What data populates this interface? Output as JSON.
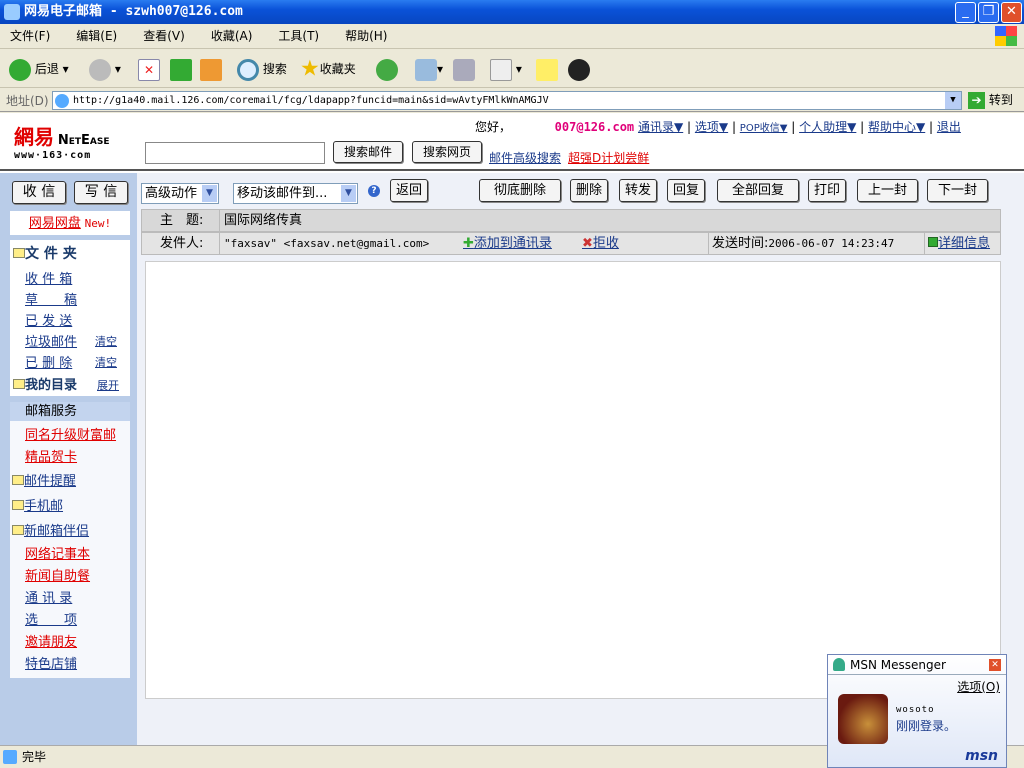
{
  "window": {
    "title": "网易电子邮箱 - szwh007@126.com"
  },
  "menu": [
    "文件(F)",
    "编辑(E)",
    "查看(V)",
    "收藏(A)",
    "工具(T)",
    "帮助(H)"
  ],
  "toolbar": {
    "back": "后退",
    "search": "搜索",
    "favorites": "收藏夹"
  },
  "address": {
    "label": "地址(D)",
    "url": "http://g1a40.mail.126.com/coremail/fcg/ldapapp?funcid=main&sid=wAvtyFMlkWnAMGJV",
    "go": "转到"
  },
  "header": {
    "logo_cn": "網易",
    "logo_en": "NetEase",
    "logo_url": "www·163·com",
    "greeting": "您好，",
    "user": "007@126.com",
    "nav": [
      "通讯录▼",
      "选项▼",
      "POP收信▼",
      "个人助理▼",
      "帮助中心▼",
      "退出"
    ],
    "search_mail": "搜索邮件",
    "search_web": "搜索网页",
    "adv_search": "邮件高级搜索",
    "promo": "超强D计划尝鲜"
  },
  "sidebar": {
    "receive": "收 信",
    "compose": "写 信",
    "netdisk": "网易网盘",
    "new": "New!",
    "folders_title": "文 件 夹",
    "folders": [
      {
        "label": "收 件 箱"
      },
      {
        "label": "草　　稿"
      },
      {
        "label": "已 发 送"
      },
      {
        "label": "垃圾邮件",
        "action": "清空"
      },
      {
        "label": "已 删 除",
        "action": "清空"
      }
    ],
    "mydir": "我的目录",
    "expand": "展开",
    "service_title": "邮箱服务",
    "services": [
      "同名升级财富邮",
      "精品贺卡",
      "邮件提醒",
      "手机邮",
      "新邮箱伴侣",
      "网络记事本",
      "新闻自助餐",
      "通 讯 录",
      "选　　项",
      "邀请朋友",
      "特色店铺"
    ]
  },
  "actions": {
    "advanced": "高级动作",
    "move": "移动该邮件到...",
    "back": "返回",
    "buttons": [
      "彻底删除",
      "删除",
      "转发",
      "回复",
      "全部回复",
      "打印",
      "上一封",
      "下一封"
    ]
  },
  "mail": {
    "subject_label": "主　题:",
    "subject": "国际网络传真",
    "from_label": "发件人:",
    "from": "\"faxsav\" <faxsav.net@gmail.com>",
    "add_contact": "添加到通讯录",
    "reject": "拒收",
    "time_label": "发送时间:",
    "time": "2006-06-07 14:23:47",
    "details": "详细信息"
  },
  "status": {
    "text": "完毕"
  },
  "msn": {
    "title": "MSN Messenger",
    "options": "选项(O)",
    "user": "wosoto",
    "message": "刚刚登录。",
    "brand": "msn"
  }
}
